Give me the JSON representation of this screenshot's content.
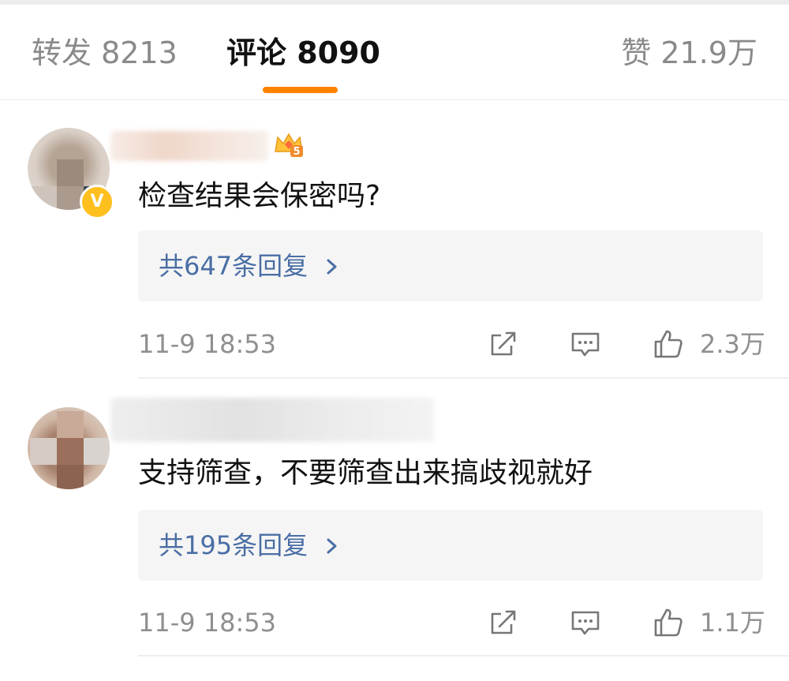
{
  "tabs": {
    "repost": "转发 8213",
    "comments": "评论 8090",
    "likes": "赞 21.9万"
  },
  "colors": {
    "accent": "#ff8200",
    "reply_link": "#4a6ea5",
    "verify": "#ffbf1e"
  },
  "comments": [
    {
      "text": "检查结果会保密吗?",
      "badge_level": "5",
      "replies": "共647条回复",
      "time": "11-9 18:53",
      "likes": "2.3万"
    },
    {
      "text": "支持筛查，不要筛查出来搞歧视就好",
      "replies": "共195条回复",
      "time": "11-9 18:53",
      "likes": "1.1万"
    }
  ],
  "icons": {
    "verified": "verified-badge-icon",
    "crown": "crown-icon",
    "chevron": "chevron-right-icon",
    "share": "share-icon",
    "comment": "comment-icon",
    "like": "thumbs-up-icon"
  }
}
